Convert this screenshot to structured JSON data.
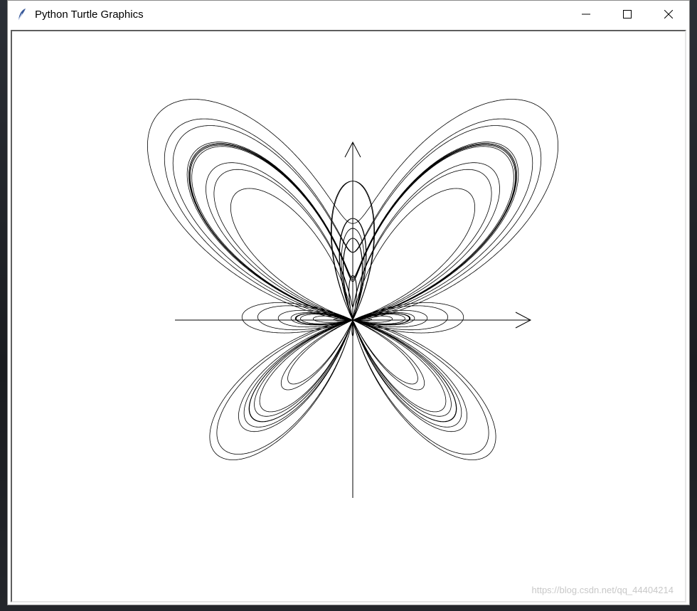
{
  "window": {
    "title": "Python Turtle Graphics",
    "app_icon": "feather-icon",
    "controls": [
      "minimize-icon",
      "maximize-icon",
      "close-icon"
    ]
  },
  "canvas": {
    "background": "#ffffff",
    "pen_color": "#000000",
    "drawing": "butterfly-curve"
  },
  "watermark": {
    "text": "https://blog.csdn.net/qq_44404214"
  }
}
